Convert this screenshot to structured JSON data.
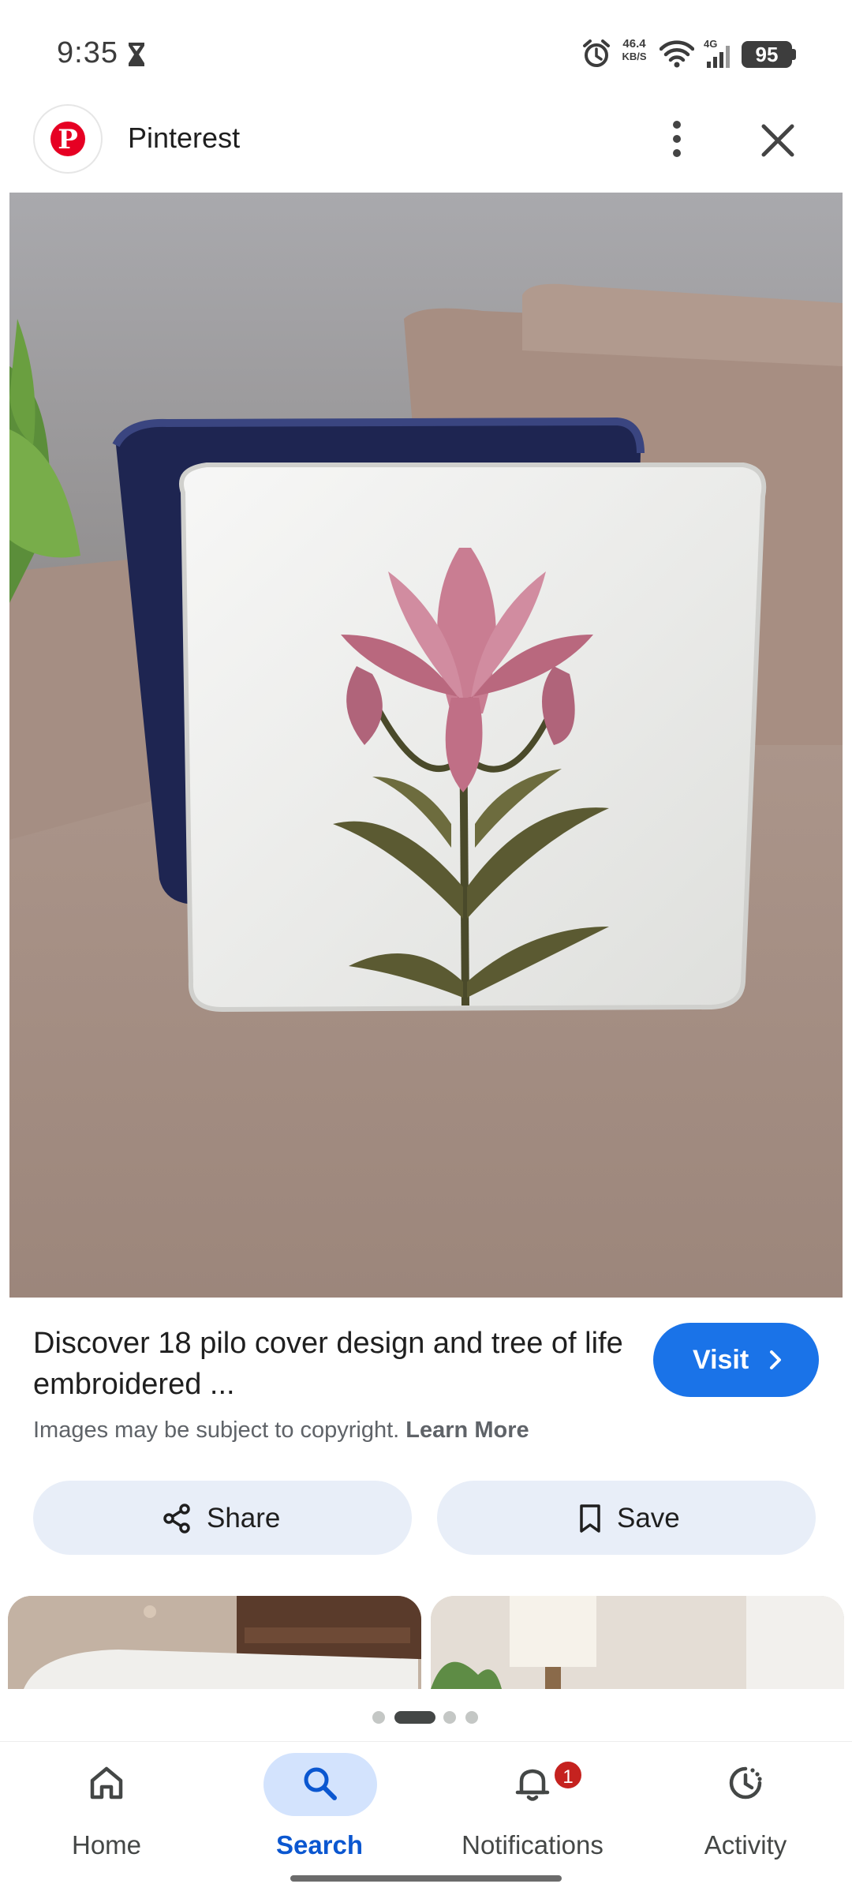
{
  "status_bar": {
    "time": "9:35",
    "net_speed_value": "46.4",
    "net_speed_unit": "KB/S",
    "network_type": "4G",
    "battery": "95"
  },
  "header": {
    "source": "Pinterest"
  },
  "result": {
    "title": "Discover 18 pilo cover design and tree of life embroidered ...",
    "visit_label": "Visit",
    "copyright_text": "Images may be subject to copyright.",
    "learn_more": "Learn More"
  },
  "actions": {
    "share_label": "Share",
    "save_label": "Save"
  },
  "pager": {
    "active_index": 1,
    "count": 4
  },
  "bottom_nav": {
    "items": [
      {
        "label": "Home",
        "icon": "home-icon"
      },
      {
        "label": "Search",
        "icon": "search-icon",
        "active": true
      },
      {
        "label": "Notifications",
        "icon": "bell-icon",
        "badge": "1"
      },
      {
        "label": "Activity",
        "icon": "activity-icon"
      }
    ]
  },
  "colors": {
    "accent": "#1a73e8",
    "pill_bg": "#e8eef8",
    "nav_active_bg": "#d3e3fd",
    "badge": "#c5221f",
    "brand": "#e60023"
  }
}
